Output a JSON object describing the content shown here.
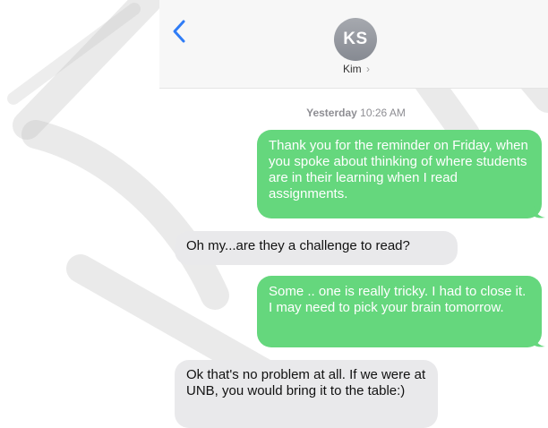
{
  "header": {
    "back_icon": "chevron-left-icon",
    "avatar_initials": "KS",
    "contact_name": "Kim",
    "contact_chevron": "›"
  },
  "timestamp": {
    "day": "Yesterday",
    "time": "10:26 AM"
  },
  "messages": [
    {
      "direction": "sent",
      "text": "Thank you for the reminder on Friday, when you spoke about thinking of where students are in their learning when I read assignments."
    },
    {
      "direction": "received",
      "text": "Oh my...are they a challenge to read?"
    },
    {
      "direction": "sent",
      "text": "Some .. one is really tricky. I had to close it. I may need to pick your brain tomorrow."
    },
    {
      "direction": "received",
      "text": "Ok that's no problem at all. If we were at UNB, you would bring it to the table:)"
    }
  ],
  "colors": {
    "sent_bubble": "#65d77d",
    "received_bubble": "#e9e9eb",
    "accent": "#2f7cf6"
  }
}
